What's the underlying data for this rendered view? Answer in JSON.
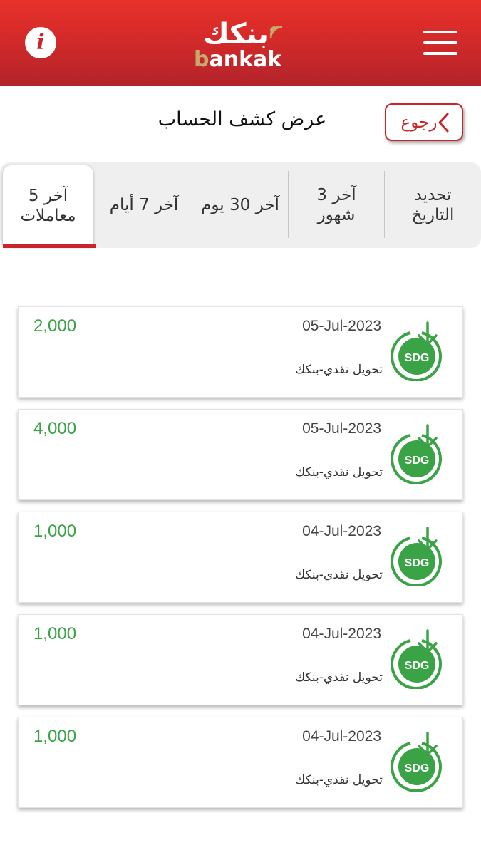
{
  "header": {
    "logo_ar": "بنكك",
    "logo_en_first": "b",
    "logo_en_rest": "ankak",
    "info_icon": "info-icon",
    "menu_icon": "hamburger-menu-icon",
    "colors": {
      "red": "#d42a2a",
      "dark_red": "#b2242b",
      "gold": "#c8a86b"
    }
  },
  "title_bar": {
    "back_label": "رجوع",
    "title": "عرض كشف الحساب"
  },
  "tabs": [
    {
      "label_line1": "آخر 5",
      "label_line2": "معاملات",
      "active": true
    },
    {
      "label_line1": "آخر 7 أيام",
      "label_line2": "",
      "active": false
    },
    {
      "label_line1": "آخر 30 يوم",
      "label_line2": "",
      "active": false
    },
    {
      "label_line1": "آخر 3",
      "label_line2": "شهور",
      "active": false
    },
    {
      "label_line1": "تحديد",
      "label_line2": "التاريخ",
      "active": false
    }
  ],
  "transactions": [
    {
      "amount": "2,000",
      "date": "05-Jul-2023",
      "description": "تحويل نقدي-بنكك",
      "currency": "SDG"
    },
    {
      "amount": "4,000",
      "date": "05-Jul-2023",
      "description": "تحويل نقدي-بنكك",
      "currency": "SDG"
    },
    {
      "amount": "1,000",
      "date": "04-Jul-2023",
      "description": "تحويل نقدي-بنكك",
      "currency": "SDG"
    },
    {
      "amount": "1,000",
      "date": "04-Jul-2023",
      "description": "تحويل نقدي-بنكك",
      "currency": "SDG"
    },
    {
      "amount": "1,000",
      "date": "04-Jul-2023",
      "description": "تحويل نقدي-بنكك",
      "currency": "SDG"
    }
  ],
  "accent_green": "#3aa346"
}
